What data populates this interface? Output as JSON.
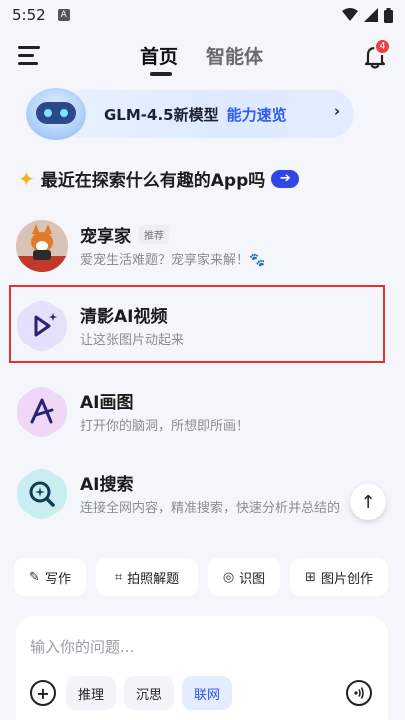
{
  "status_bar": {
    "time": "5:52",
    "app_icon_letter": "A"
  },
  "header": {
    "tabs": [
      {
        "label": "首页",
        "active": true
      },
      {
        "label": "智能体",
        "active": false
      }
    ],
    "notification_count": "4"
  },
  "banner": {
    "title": "GLM-4.5新模型",
    "link": "能力速览",
    "arrow": "›"
  },
  "explore": {
    "text": "最近在探索什么有趣的App吗",
    "arrow": "➔"
  },
  "apps": [
    {
      "title": "宠享家",
      "tag": "推荐",
      "desc": "爱宠生活难题？宠享家来解！🐾"
    },
    {
      "title": "清影AI视频",
      "desc": "让这张图片动起来",
      "highlighted": true
    },
    {
      "title": "AI画图",
      "desc": "打开你的脑洞，所想即所画！"
    },
    {
      "title": "AI搜索",
      "desc": "连接全网内容，精准搜索，快速分析并总结的"
    }
  ],
  "scroll_top_icon": "↑",
  "quick_actions": [
    {
      "label": "写作",
      "icon": "pen-icon"
    },
    {
      "label": "拍照解题",
      "icon": "camera-solve-icon"
    },
    {
      "label": "识图",
      "icon": "lens-icon"
    },
    {
      "label": "图片创作",
      "icon": "image-create-icon"
    }
  ],
  "composer": {
    "placeholder": "输入你的问题...",
    "modes": [
      {
        "label": "推理",
        "active": false
      },
      {
        "label": "沉思",
        "active": false
      },
      {
        "label": "联网",
        "active": true
      }
    ]
  },
  "colors": {
    "accent": "#2f45e8",
    "highlight_border": "#e0342f",
    "badge": "#ee3b3b"
  }
}
